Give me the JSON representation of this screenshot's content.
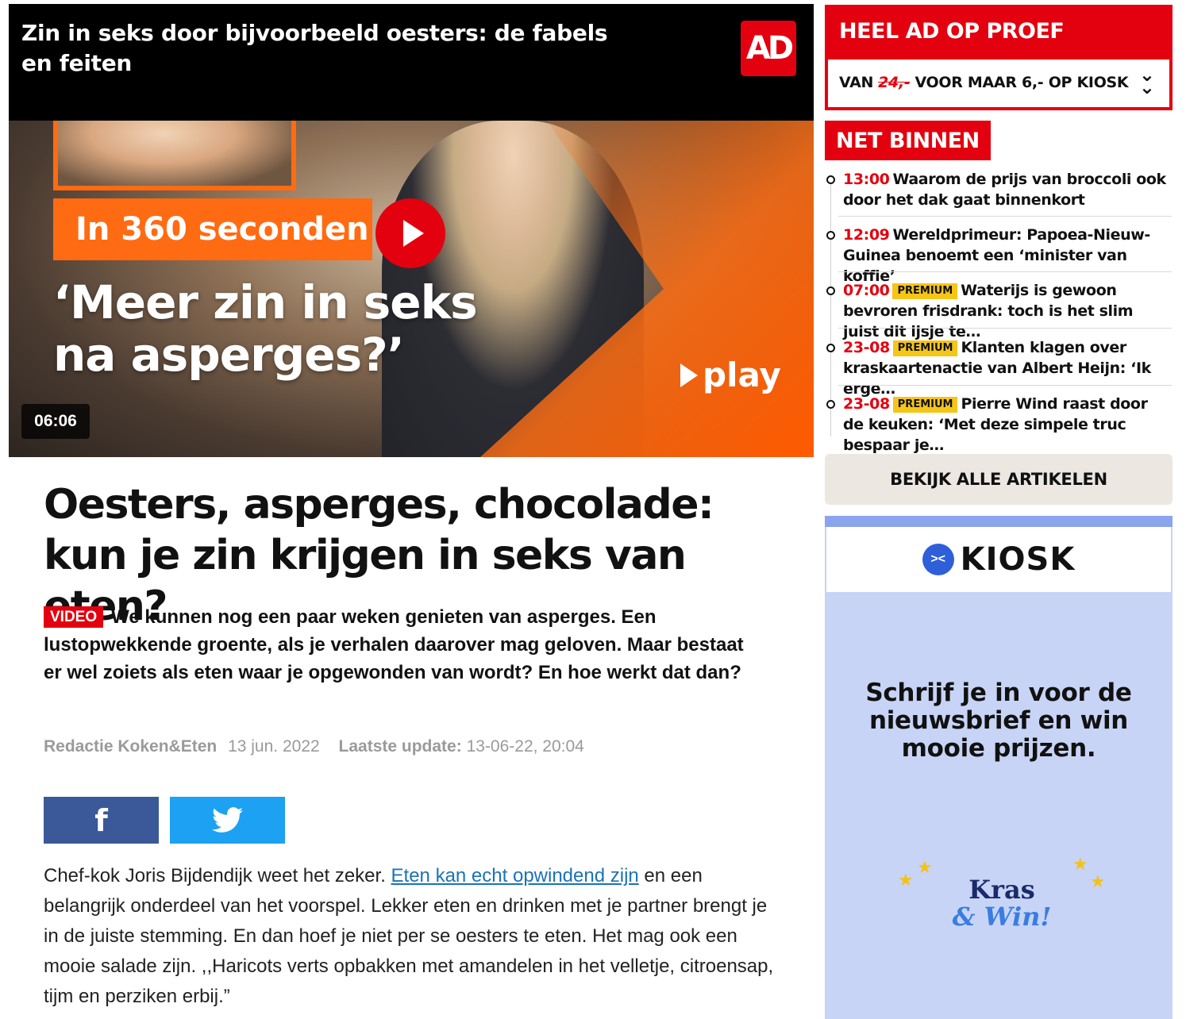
{
  "video": {
    "title": "Zin in seks door bijvoorbeeld oesters: de fabels en feiten",
    "logo": "AD",
    "badge": "In 360 seconden",
    "quote_line1": "‘Meer zin in seks",
    "quote_line2": "na asperges?’",
    "brand": "play",
    "duration": "06:06"
  },
  "article": {
    "headline": "Oesters, asperges, chocolade: kun je zin krijgen in seks van eten?",
    "label": "VIDEO",
    "intro": "We kunnen nog een paar weken genieten van asperges. Een lustopwekkende groente, als je verhalen daarover mag geloven. Maar bestaat er wel zoiets als eten waar je opgewonden van wordt? En hoe werkt dat dan?",
    "author": "Redactie Koken&Eten",
    "date": "13 jun. 2022",
    "update_label": "Laatste update:",
    "update_value": "13-06-22, 20:04",
    "facebook_icon": "f",
    "body_before": "Chef-kok Joris Bijdendijk weet het zeker. ",
    "body_link": "Eten kan echt opwindend zijn",
    "body_after": " en een belangrijk onderdeel van het voorspel. Lekker eten en drinken met je partner brengt je in de juiste stemming. En dan hoef je niet per se oesters te eten. Het mag ook een mooie salade zijn. ,,Haricots verts opbakken met amandelen in het velletje, citroensap, tijm en perziken erbij.”"
  },
  "promo": {
    "title": "HEEL AD OP PROEF",
    "text_before": "VAN",
    "old_price": "24,-",
    "text_after": "VOOR MAAR 6,- OP KIOSK",
    "chevron": "⌄"
  },
  "net_binnen": {
    "title": "NET BINNEN",
    "items": [
      {
        "time": "13:00",
        "premium": "",
        "text": "Waarom de prijs van broccoli ook door het dak gaat binnenkort"
      },
      {
        "time": "12:09",
        "premium": "",
        "text": "Wereldprimeur: Papoea-Nieuw-Guinea benoemt een ‘minister van koffie’"
      },
      {
        "time": "07:00",
        "premium": "PREMIUM",
        "text": "Waterijs is gewoon bevroren frisdrank: toch is het slim juist dit ijsje te…"
      },
      {
        "time": "23-08",
        "premium": "PREMIUM",
        "text": "Klanten klagen over kraskaartenactie van Albert Heijn: ‘Ik erge…"
      },
      {
        "time": "23-08",
        "premium": "PREMIUM",
        "text": "Pierre Wind raast door de keuken: ‘Met deze simpele truc bespaar je…"
      }
    ],
    "all_button": "BEKIJK ALLE ARTIKELEN"
  },
  "kiosk_ad": {
    "brand": "KIOSK",
    "text": "Schrijf je in voor de nieuwsbrief en win mooie prijzen.",
    "kras_line1": "Kras",
    "kras_line2": "& Win!"
  },
  "colors": {
    "brand_red": "#e3000f",
    "premium_yellow": "#f5c518",
    "facebook": "#3b5998",
    "twitter": "#1da1f2",
    "kiosk_bg": "#c7d4f6"
  }
}
